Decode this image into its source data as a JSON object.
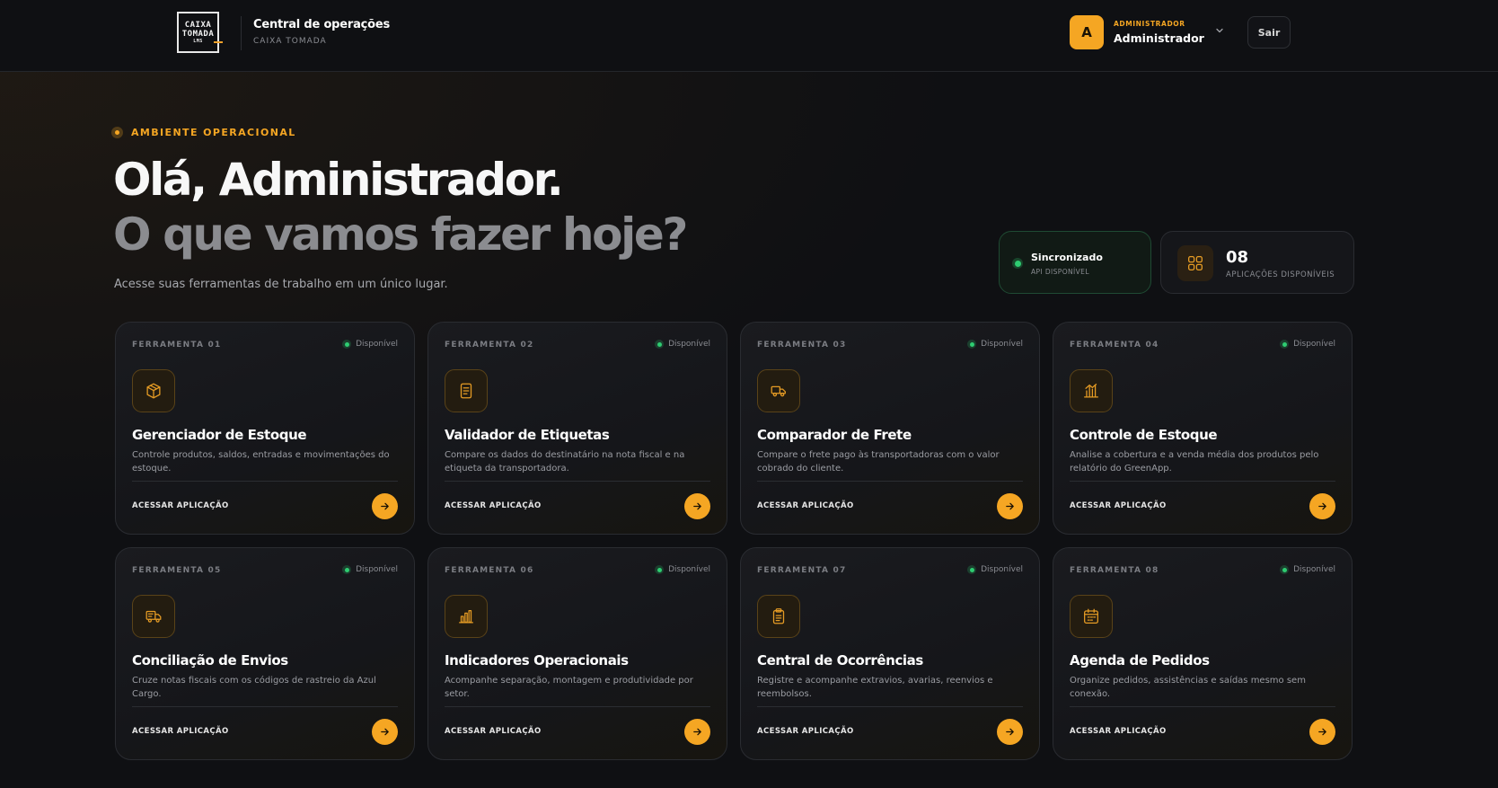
{
  "header": {
    "logo_line1": "CAIXA",
    "logo_line2": "TOMADA",
    "logo_sub": "LMS",
    "title": "Central de operações",
    "subtitle": "CAIXA TOMADA",
    "user_initial": "A",
    "user_role": "ADMINISTRADOR",
    "user_name": "Administrador",
    "logout_label": "Sair"
  },
  "hero": {
    "eyebrow": "AMBIENTE OPERACIONAL",
    "title_line1": "Olá, Administrador.",
    "title_line2": "O que vamos fazer hoje?",
    "description": "Acesse suas ferramentas de trabalho em um único lugar."
  },
  "status": {
    "sync_title": "Sincronizado",
    "sync_sub": "API DISPONÍVEL",
    "apps_count": "08",
    "apps_label": "APLICAÇÕES DISPONÍVEIS"
  },
  "colors": {
    "accent": "#f5a623",
    "success": "#2ecc71",
    "background": "#0f1013"
  },
  "tools": [
    {
      "num": "FERRAMENTA 01",
      "status": "Disponível",
      "icon": "box-icon",
      "title": "Gerenciador de Estoque",
      "desc": "Controle produtos, saldos, entradas e movimentações do estoque.",
      "action": "ACESSAR APLICAÇÃO"
    },
    {
      "num": "FERRAMENTA 02",
      "status": "Disponível",
      "icon": "document-icon",
      "title": "Validador de Etiquetas",
      "desc": "Compare os dados do destinatário na nota fiscal e na etiqueta da transportadora.",
      "action": "ACESSAR APLICAÇÃO"
    },
    {
      "num": "FERRAMENTA 03",
      "status": "Disponível",
      "icon": "truck-icon",
      "title": "Comparador de Frete",
      "desc": "Compare o frete pago às transportadoras com o valor cobrado do cliente.",
      "action": "ACESSAR APLICAÇÃO"
    },
    {
      "num": "FERRAMENTA 04",
      "status": "Disponível",
      "icon": "chart-icon",
      "title": "Controle de Estoque",
      "desc": "Analise a cobertura e a venda média dos produtos pelo relatório do GreenApp.",
      "action": "ACESSAR APLICAÇÃO"
    },
    {
      "num": "FERRAMENTA 05",
      "status": "Disponível",
      "icon": "delivery-icon",
      "title": "Conciliação de Envios",
      "desc": "Cruze notas fiscais com os códigos de rastreio da Azul Cargo.",
      "action": "ACESSAR APLICAÇÃO"
    },
    {
      "num": "FERRAMENTA 06",
      "status": "Disponível",
      "icon": "bar-chart-icon",
      "title": "Indicadores Operacionais",
      "desc": "Acompanhe separação, montagem e produtividade por setor.",
      "action": "ACESSAR APLICAÇÃO"
    },
    {
      "num": "FERRAMENTA 07",
      "status": "Disponível",
      "icon": "clipboard-icon",
      "title": "Central de Ocorrências",
      "desc": "Registre e acompanhe extravios, avarias, reenvios e reembolsos.",
      "action": "ACESSAR APLICAÇÃO"
    },
    {
      "num": "FERRAMENTA 08",
      "status": "Disponível",
      "icon": "calendar-icon",
      "title": "Agenda de Pedidos",
      "desc": "Organize pedidos, assistências e saídas mesmo sem conexão.",
      "action": "ACESSAR APLICAÇÃO"
    }
  ]
}
